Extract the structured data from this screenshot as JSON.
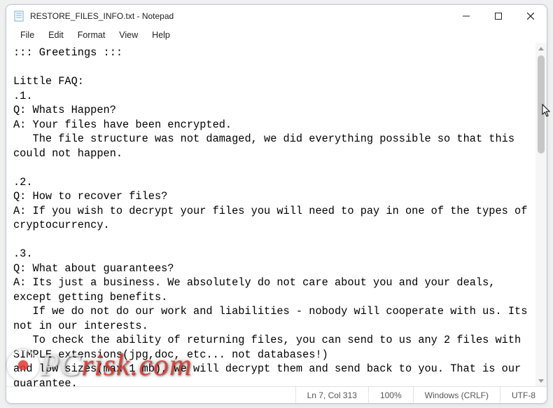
{
  "titlebar": {
    "title": "RESTORE_FILES_INFO.txt - Notepad"
  },
  "menu": {
    "items": [
      "File",
      "Edit",
      "Format",
      "View",
      "Help"
    ]
  },
  "document": {
    "text": "::: Greetings :::\n\nLittle FAQ:\n.1.\nQ: Whats Happen?\nA: Your files have been encrypted.\n   The file structure was not damaged, we did everything possible so that this could not happen.\n\n.2.\nQ: How to recover files?\nA: If you wish to decrypt your files you will need to pay in one of the types of cryptocurrency.\n\n.3.\nQ: What about guarantees?\nA: Its just a business. We absolutely do not care about you and your deals, except getting benefits.\n   If we do not do our work and liabilities - nobody will cooperate with us. Its not in our interests.\n   To check the ability of returning files, you can send to us any 2 files with SIMPLE extensions(jpg,doc, etc... not databases!)\nand low sizes(max 1 mb), we will decrypt them and send back to you. That is our guarantee."
  },
  "status": {
    "position": "Ln 7, Col 313",
    "zoom": "100%",
    "line_endings": "Windows (CRLF)",
    "encoding": "UTF-8"
  },
  "watermark": {
    "prefix": "PC",
    "suffix": "risk.com"
  }
}
